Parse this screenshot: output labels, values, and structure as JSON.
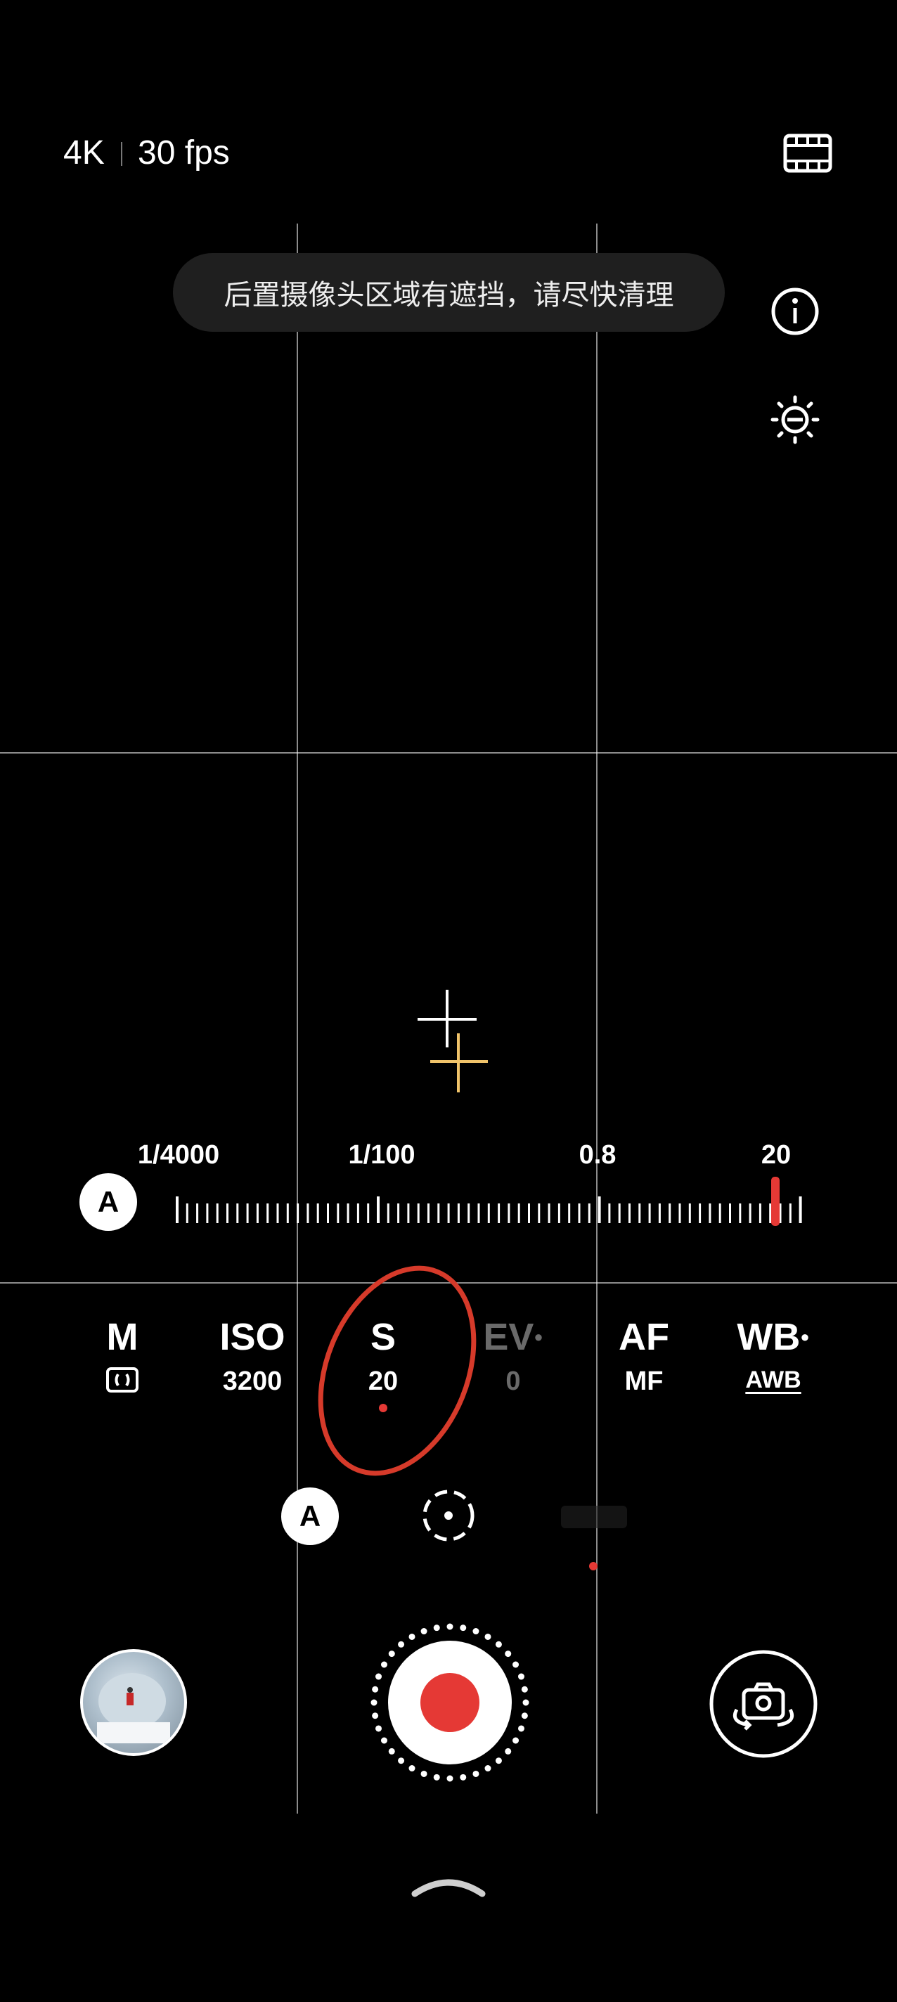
{
  "top_bar": {
    "resolution": "4K",
    "frame_rate": "30 fps",
    "video_settings_icon": "film-icon"
  },
  "notice": {
    "text": "后置摄像头区域有遮挡，请尽快清理"
  },
  "side_icons": [
    "info-icon",
    "exposure-icon"
  ],
  "shutter_ruler": {
    "auto_label": "A",
    "tick_labels": [
      "1/4000",
      "1/100",
      "0.8",
      "20"
    ],
    "selected_value": "20"
  },
  "params": [
    {
      "name": "M",
      "value_icon": "metering-icon",
      "value": ""
    },
    {
      "name": "ISO",
      "value": "3200"
    },
    {
      "name": "S",
      "value": "20",
      "active": true
    },
    {
      "name": "EV",
      "value": "0",
      "disabled": true
    },
    {
      "name": "AF",
      "value": "MF"
    },
    {
      "name": "WB",
      "value": "AWB"
    }
  ],
  "sub_controls": {
    "auto_label": "A"
  },
  "colors": {
    "accent_red": "#e53935",
    "annotation_red": "#d63a2a",
    "focus_yellow": "#f0c36a"
  }
}
